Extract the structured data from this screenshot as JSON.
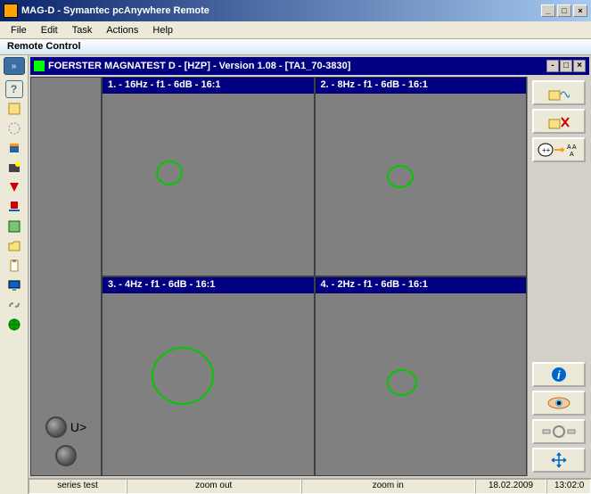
{
  "titlebar": {
    "title": "MAG-D - Symantec pcAnywhere Remote"
  },
  "menu": {
    "file": "File",
    "edit": "Edit",
    "task": "Task",
    "actions": "Actions",
    "help": "Help"
  },
  "remote_control_label": "Remote Control",
  "inner_window": {
    "title": "FOERSTER MAGNATEST D - [HZP] - Version 1.08 - [TA1_70-3830]"
  },
  "cells": [
    {
      "header": "1. - 16Hz - f1 - 6dB - 16:1"
    },
    {
      "header": "2. - 8Hz - f1 - 6dB - 16:1"
    },
    {
      "header": "3. - 4Hz - f1 - 6dB - 16:1"
    },
    {
      "header": "4. - 2Hz - f1 - 6dB - 16:1"
    }
  ],
  "led_label": "U>",
  "status": {
    "series": "series test",
    "zoom_out": "zoom out",
    "zoom_in": "zoom in",
    "date": "18.02.2009",
    "time": "13:02:0"
  },
  "toggle_glyph": "»",
  "window_controls": {
    "min": "_",
    "max": "□",
    "close": "×"
  },
  "inner_controls": {
    "min": "-",
    "max": "□",
    "close": "×"
  }
}
